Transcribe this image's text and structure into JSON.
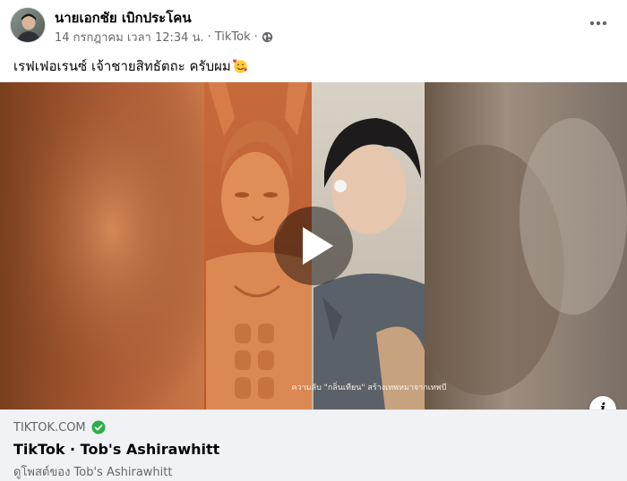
{
  "post": {
    "author": "นายเอกชัย เบิกประโคน",
    "date": "14 กรกฎาคม เวลา 12:34 น.",
    "separator": "·",
    "source": "TikTok",
    "caption": "เรฟเฟอเรนซ์ เจ้าชายสิทธัตถะ ครับผม",
    "caption_emoji": "smiling-face-with-hearts-icon"
  },
  "video": {
    "overlay_text": "ความลับ \"กลิ่นเทียน\" สร้างเทพหมาจากเทพบี",
    "play_icon": "play-icon",
    "info_label": "i"
  },
  "link": {
    "domain": "TIKTOK.COM",
    "title": "TikTok · Tob's Ashirawhitt",
    "description": "ดูโพสต์ของ Tob's Ashirawhitt"
  },
  "colors": {
    "accent_verified": "#2ab046",
    "muted_text": "#65676b",
    "card_bg": "#f0f2f5"
  }
}
